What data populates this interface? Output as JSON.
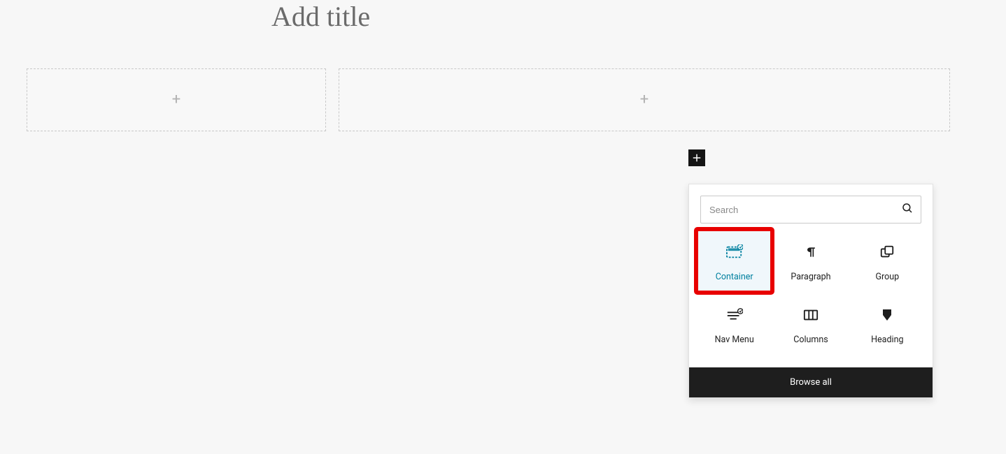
{
  "title": {
    "placeholder": "Add title"
  },
  "columns": {
    "left_plus": "+",
    "right_plus": "+"
  },
  "inserter": {
    "search_placeholder": "Search",
    "blocks": [
      {
        "name": "Container",
        "selected": true
      },
      {
        "name": "Paragraph",
        "selected": false
      },
      {
        "name": "Group",
        "selected": false
      },
      {
        "name": "Nav Menu",
        "selected": false
      },
      {
        "name": "Columns",
        "selected": false
      },
      {
        "name": "Heading",
        "selected": false
      }
    ],
    "browse_all": "Browse all"
  },
  "icons": {
    "add_block": "plus-icon",
    "search": "search-icon"
  }
}
